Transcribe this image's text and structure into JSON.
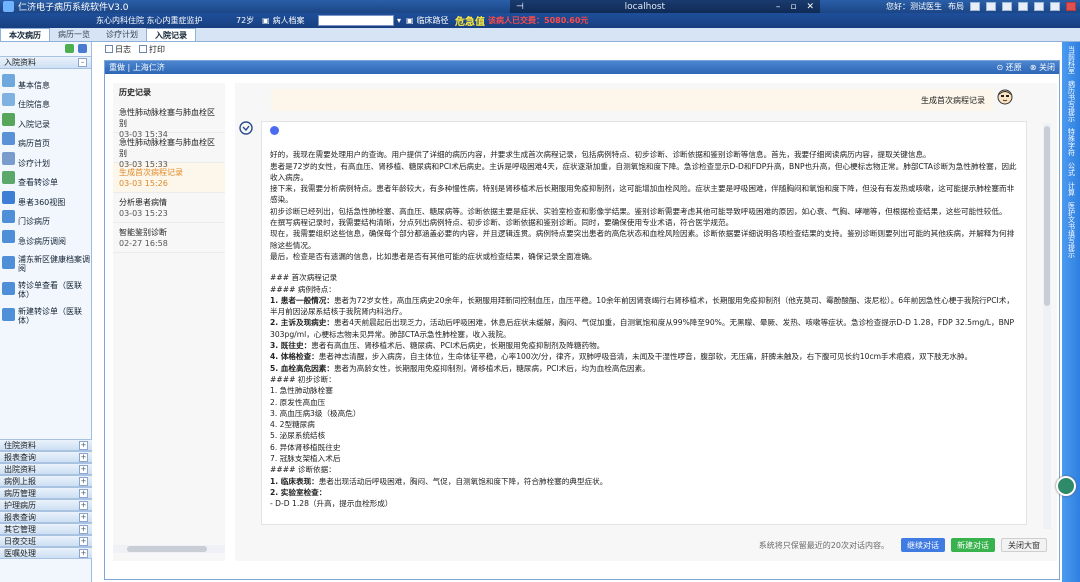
{
  "titlebar": {
    "app_title": "仁济电子病历系统软件V3.0",
    "remote_host": "localhost",
    "user_label": "您好：测试医生",
    "right_label": "布局"
  },
  "infobar": {
    "ward": "东心内科住院  东心内重症监护",
    "age": "72岁",
    "archive": "病人档案",
    "pathway": "临床路径",
    "alert_title": "危急值",
    "cost": "该病人已交费：5080.60元"
  },
  "tabs": [
    {
      "label": "本次病历",
      "active": true
    },
    {
      "label": "病历一览",
      "active": false
    },
    {
      "label": "诊疗计划",
      "active": false
    },
    {
      "label": "入院记录",
      "active": true
    }
  ],
  "sidebar": {
    "section_title": "入院资料",
    "items": [
      "基本信息",
      "住院信息",
      "入院记录",
      "病历首页",
      "诊疗计划",
      "查看转诊单",
      "患者360视图",
      "门诊病历",
      "急诊病历调阅",
      "浦东新区健康档案调阅",
      "转诊单查看（医联体）",
      "新建转诊单（医联体）"
    ],
    "bottom_sections": [
      "住院资料",
      "报表查询",
      "出院资料",
      "病例上报",
      "病历管理",
      "护理病历",
      "报表查询",
      "其它管理",
      "日夜交班",
      "医嘱处理"
    ]
  },
  "main": {
    "tools": [
      "日志",
      "打印"
    ],
    "panel_title": "重做 | 上海仁济",
    "panel_actions": [
      "还原",
      "关闭"
    ],
    "history": {
      "title": "历史记录",
      "items": [
        {
          "name": "急性肺动脉栓塞与肺血栓区别",
          "time": "03-03 15:34",
          "active": false
        },
        {
          "name": "急性肺动脉栓塞与肺血栓区别",
          "time": "03-03 15:33",
          "active": false
        },
        {
          "name": "生成首次病程记录",
          "time": "03-03 15:26",
          "active": true
        },
        {
          "name": "分析患者病情",
          "time": "03-03 15:23",
          "active": false
        },
        {
          "name": "智能鉴别诊断",
          "time": "02-27 16:58",
          "active": false
        }
      ]
    },
    "user_message": "生成首次病程记录",
    "answer_lines": [
      "好的，我现在需要处理用户的查询。用户提供了详细的病历内容，并要求生成首次病程记录，包括病例特点、初步诊断、诊断依据和鉴别诊断等信息。首先，我要仔细阅读病历内容，提取关键信息。",
      "患者是72岁的女性，有高血压、肾移植、糖尿病和PCI术后病史。主诉是呼吸困难4天，症状逐渐加重，自测氧饱和度下降。急诊检查显示D-D和FDP升高，BNP也升高，但心梗标志物正常。肺部CTA诊断为急性肺栓塞，因此收入病房。",
      "接下来，我需要分析病例特点。患者年龄较大，有多种慢性病，特别是肾移植术后长期服用免疫抑制剂，这可能增加血栓风险。症状主要是呼吸困难，伴随胸闷和氧饱和度下降，但没有有发热或咳嗽，这可能提示肺栓塞而非感染。",
      "初步诊断已经列出，包括急性肺栓塞、高血压、糖尿病等。诊断依据主要是症状、实验室检查和影像学结果。鉴别诊断需要考虑其他可能导致呼吸困难的原因，如心衰、气胸、哮喘等，但根据检查结果，这些可能性较低。",
      "在撰写病程记录时，我需要结构清晰，分点列出病例特点、初步诊断、诊断依据和鉴别诊断。同时，要确保使用专业术语，符合医学规范。",
      "现在，我需要组织这些信息，确保每个部分都涵盖必要的内容，并且逻辑连贯。病例特点要突出患者的高危状态和血栓风险因素。诊断依据要详细说明各项检查结果的支持。鉴别诊断则要列出可能的其他疾病，并解释为何排除这些情况。",
      "最后，检查是否有遗漏的信息，比如患者是否有其他可能的症状或检查结果，确保记录全面准确。"
    ],
    "record_title": "### 首次病程记录",
    "features_heading": "#### 病例特点：",
    "features": [
      {
        "label": "1. 患者一般情况：",
        "text": "患者为72岁女性，高血压病史20余年，长期服用拜新同控制血压，血压平稳。10余年前因肾衰竭行右肾移植术，长期服用免疫抑制剂（他克莫司、霉酚酸酯、泼尼松）。6年前因急性心梗于我院行PCI术，半月前因泌尿系结核于我院肾内科治疗。"
      },
      {
        "label": "2. 主诉及现病史：",
        "text": "患者4天前晨起后出现乏力，活动后呼吸困难，休息后症状未缓解，胸闷、气促加重，自测氧饱和度从99%降至90%。无黑矇、晕厥、发热、咳嗽等症状。急诊检查提示D-D 1.28，FDP 32.5mg/L，BNP 303pg/ml，心梗标志物未见异常。肺部CTA示急性肺栓塞，收入我院。"
      },
      {
        "label": "3. 既往史：",
        "text": "患者有高血压、肾移植术后、糖尿病、PCI术后病史，长期服用免疫抑制剂及降糖药物。"
      },
      {
        "label": "4. 体格检查：",
        "text": "患者神志清醒，步入病房，自主体位，生命体征平稳，心率100次/分，律齐，双肺呼吸音清，未闻及干湿性啰音，腹部软，无压痛，肝脾未触及，右下腹可见长约10cm手术疤痕，双下肢无水肿。"
      },
      {
        "label": "5. 血栓高危因素：",
        "text": "患者为高龄女性，长期服用免疫抑制剂，肾移植术后，糖尿病，PCI术后，均为血栓高危因素。"
      }
    ],
    "diagnosis_heading": "#### 初步诊断：",
    "diagnoses": [
      "1. 急性肺动脉栓塞",
      "2. 原发性高血压",
      "3. 高血压病3级（极高危）",
      "4. 2型糖尿病",
      "5. 泌尿系统结核",
      "6. 异体肾移植既往史",
      "7. 冠脉支架植入术后"
    ],
    "basis_heading": "#### 诊断依据：",
    "basis": [
      {
        "label": "1. 临床表现：",
        "text": "患者出现活动后呼吸困难，胸闷、气促，自测氧饱和度下降，符合肺栓塞的典型症状。"
      },
      {
        "label": "2. 实验室检查：",
        "text": ""
      },
      {
        "label": "",
        "text": "- D-D 1.28（升高，提示血栓形成）"
      }
    ],
    "footer_note": "系统将只保留最近的20次对话内容。",
    "buttons": {
      "continue": "继续对话",
      "new": "新建对话",
      "close": "关闭大窗"
    }
  },
  "right_panel": [
    "当前科室",
    "病历书写提示",
    "特殊字符",
    "公式",
    "计算",
    "医护文书填写提示"
  ],
  "colors": {
    "titlebar": "#1b4585",
    "accent": "#3f7be0",
    "active_history": "#e08a2a",
    "green": "#37b24d"
  }
}
